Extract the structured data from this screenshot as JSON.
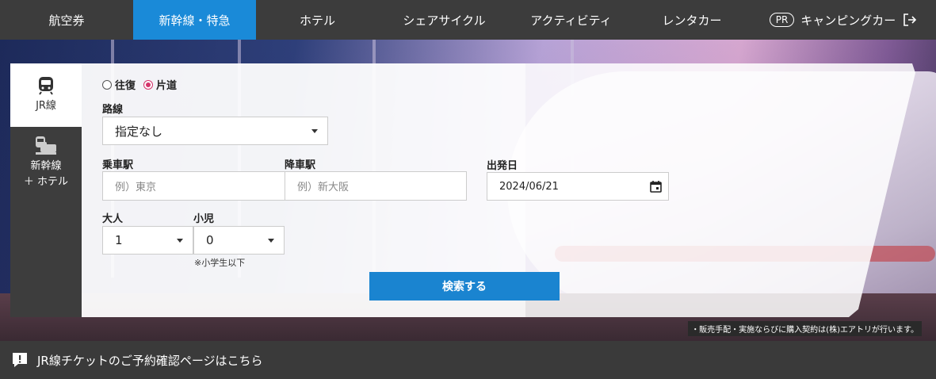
{
  "nav": {
    "items": [
      {
        "label": "航空券"
      },
      {
        "label": "新幹線・特急"
      },
      {
        "label": "ホテル"
      },
      {
        "label": "シェアサイクル"
      },
      {
        "label": "アクティビティ"
      },
      {
        "label": "レンタカー"
      },
      {
        "label": "キャンピングカー",
        "badge": "PR"
      }
    ],
    "active_index": 1,
    "active_color": "#1a8ad8"
  },
  "side_tabs": [
    {
      "label": "JR線",
      "icon": "train-icon"
    },
    {
      "label_line1": "新幹線",
      "label_line2": "＋ ホテル",
      "icon": "train-hotel-icon"
    }
  ],
  "form": {
    "trip_type": {
      "options": [
        "往復",
        "片道"
      ],
      "selected": "片道"
    },
    "route": {
      "label": "路線",
      "value": "指定なし"
    },
    "from": {
      "label": "乗車駅",
      "placeholder": "例）東京"
    },
    "to": {
      "label": "降車駅",
      "placeholder": "例）新大阪"
    },
    "date": {
      "label": "出発日",
      "value": "2024/06/21"
    },
    "adults": {
      "label": "大人",
      "value": "1"
    },
    "children": {
      "label": "小児",
      "value": "0",
      "note": "※小学生以下"
    },
    "search_label": "検索する",
    "button_color": "#1a84d0"
  },
  "disclaimer": "・販売手配・実施ならびに購入契約は(株)エアトリが行います。",
  "bottom_bar": {
    "label": "JR線チケットのご予約確認ページはこちら"
  }
}
